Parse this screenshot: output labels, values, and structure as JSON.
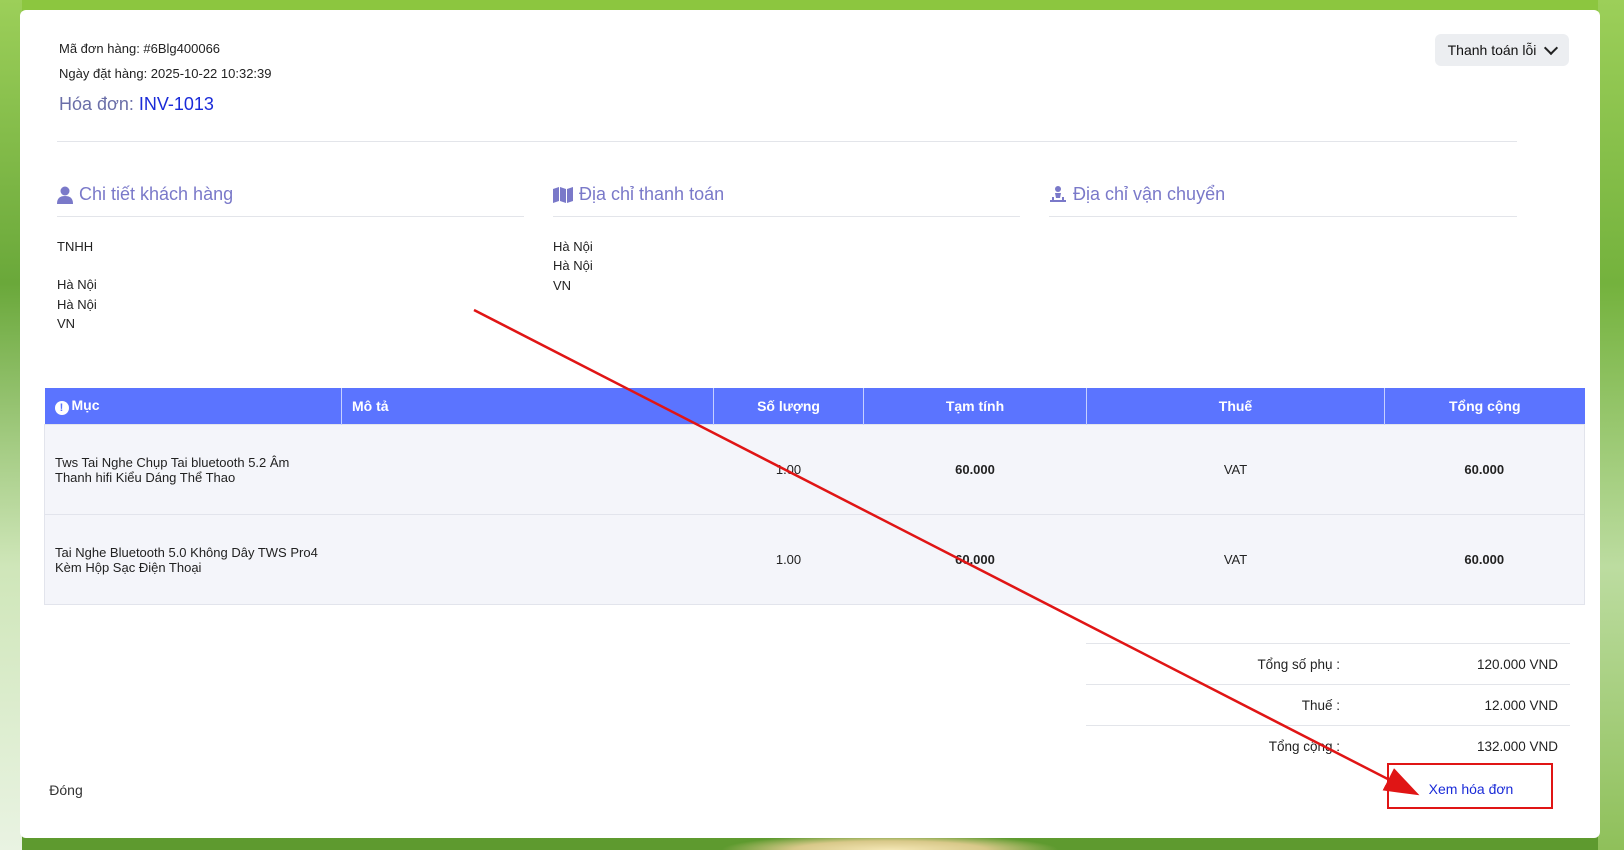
{
  "order": {
    "code_label": "Mã đơn hàng: #6Blg400066",
    "date_label": "Ngày đặt hàng: 2025-10-22 10:32:39",
    "invoice_prefix": "Hóa đơn: ",
    "invoice_no": "INV-1013"
  },
  "status_button": {
    "label": "Thanh toán lỗi"
  },
  "sections": {
    "customer": {
      "title": "Chi tiết khách hàng",
      "icon": "user-icon",
      "lines": [
        "TNHH",
        "",
        "Hà Nội",
        "Hà Nội",
        "VN"
      ]
    },
    "billing": {
      "title": "Địa chỉ thanh toán",
      "icon": "map-icon",
      "lines": [
        "Hà Nội",
        "Hà Nội",
        "VN"
      ]
    },
    "shipping": {
      "title": "Địa chỉ vận chuyển",
      "icon": "person-dolly-icon",
      "lines": []
    }
  },
  "table": {
    "headers": [
      "Mục",
      "Mô tả",
      "Số lượng",
      "Tạm tính",
      "Thuế",
      "Tổng cộng"
    ],
    "rows": [
      {
        "item_line1": "Tws Tai Nghe Chụp Tai bluetooth 5.2 Âm",
        "item_line2": "Thanh hifi Kiểu Dáng Thể Thao",
        "description": "",
        "qty": "1.00",
        "subtotal": "60.000",
        "tax": "VAT",
        "total": "60.000"
      },
      {
        "item_line1": "Tai Nghe Bluetooth 5.0 Không Dây TWS Pro4",
        "item_line2": "Kèm Hộp Sạc Điện Thoại",
        "description": "",
        "qty": "1.00",
        "subtotal": "60.000",
        "tax": "VAT",
        "total": "60.000"
      }
    ]
  },
  "totals": {
    "subtotal_label": "Tổng số phụ :",
    "subtotal_value": "120.000 VND",
    "tax_label": "Thuế :",
    "tax_value": "12.000 VND",
    "total_label": "Tổng cộng :",
    "total_value": "132.000 VND"
  },
  "footer": {
    "close_label": "Đóng",
    "view_invoice_label": "Xem hóa đơn"
  },
  "annotation": {
    "color": "#e01515"
  },
  "colors": {
    "accent": "#5b74ff",
    "section_title": "#7a79c9",
    "link": "#1a2bd8"
  }
}
